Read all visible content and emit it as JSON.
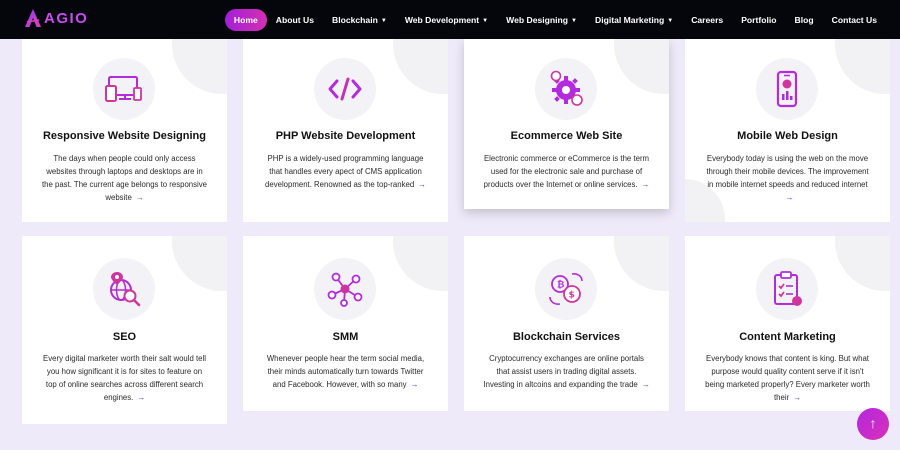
{
  "brand": {
    "name": "AGIO",
    "accent": "#b42bde"
  },
  "nav": {
    "items": [
      {
        "label": "Home",
        "active": true,
        "dropdown": false
      },
      {
        "label": "About Us",
        "dropdown": false
      },
      {
        "label": "Blockchain",
        "dropdown": true
      },
      {
        "label": "Web Development",
        "dropdown": true
      },
      {
        "label": "Web Designing",
        "dropdown": true
      },
      {
        "label": "Digital Marketing",
        "dropdown": true
      },
      {
        "label": "Careers",
        "dropdown": false
      },
      {
        "label": "Portfolio",
        "dropdown": false
      },
      {
        "label": "Blog",
        "dropdown": false
      },
      {
        "label": "Contact Us",
        "dropdown": false
      }
    ]
  },
  "services": [
    {
      "title": "Responsive Website Designing",
      "icon": "devices-icon",
      "lines": [
        "The days when people could only access",
        "websites through laptops and desktops are in",
        "the past. The current age belongs to responsive",
        "website"
      ]
    },
    {
      "title": "PHP Website Development",
      "icon": "code-icon",
      "lines": [
        "PHP is a widely-used programming language",
        "that handles every apect of CMS application",
        "development. Renowned as the top-ranked"
      ]
    },
    {
      "title": "Ecommerce Web Site",
      "icon": "ecommerce-gear-icon",
      "lines": [
        "Electronic commerce or eCommerce is the term",
        "used for the electronic sale and purchase of",
        "products over the Internet or online services."
      ]
    },
    {
      "title": "Mobile Web Design",
      "icon": "mobile-chart-icon",
      "lines": [
        "Everybody today is using the web on the move",
        "through their mobile devices. The improvement",
        "in mobile internet speeds and reduced internet",
        ""
      ]
    },
    {
      "title": "SEO",
      "icon": "seo-globe-search-icon",
      "lines": [
        "Every digital marketer worth their salt would tell",
        "you how significant it is for sites to feature on",
        "top of online searches across different search",
        "engines."
      ]
    },
    {
      "title": "SMM",
      "icon": "network-nodes-icon",
      "lines": [
        "Whenever people hear the term social media,",
        "their minds automatically turn towards Twitter",
        "and Facebook. However, with so many"
      ]
    },
    {
      "title": "Blockchain Services",
      "icon": "crypto-exchange-icon",
      "lines": [
        "Cryptocurrency exchanges are online portals",
        "that assist users in trading digital assets.",
        "Investing in altcoins and expanding the trade"
      ]
    },
    {
      "title": "Content Marketing",
      "icon": "content-checklist-icon",
      "lines": [
        "Everybody knows that content is king. But what",
        "purpose would quality content serve if it isn't",
        "being marketed properly? Every marketer worth",
        "their"
      ]
    }
  ],
  "scroll_top": {
    "icon": "arrow-up-icon",
    "glyph": "↑"
  }
}
